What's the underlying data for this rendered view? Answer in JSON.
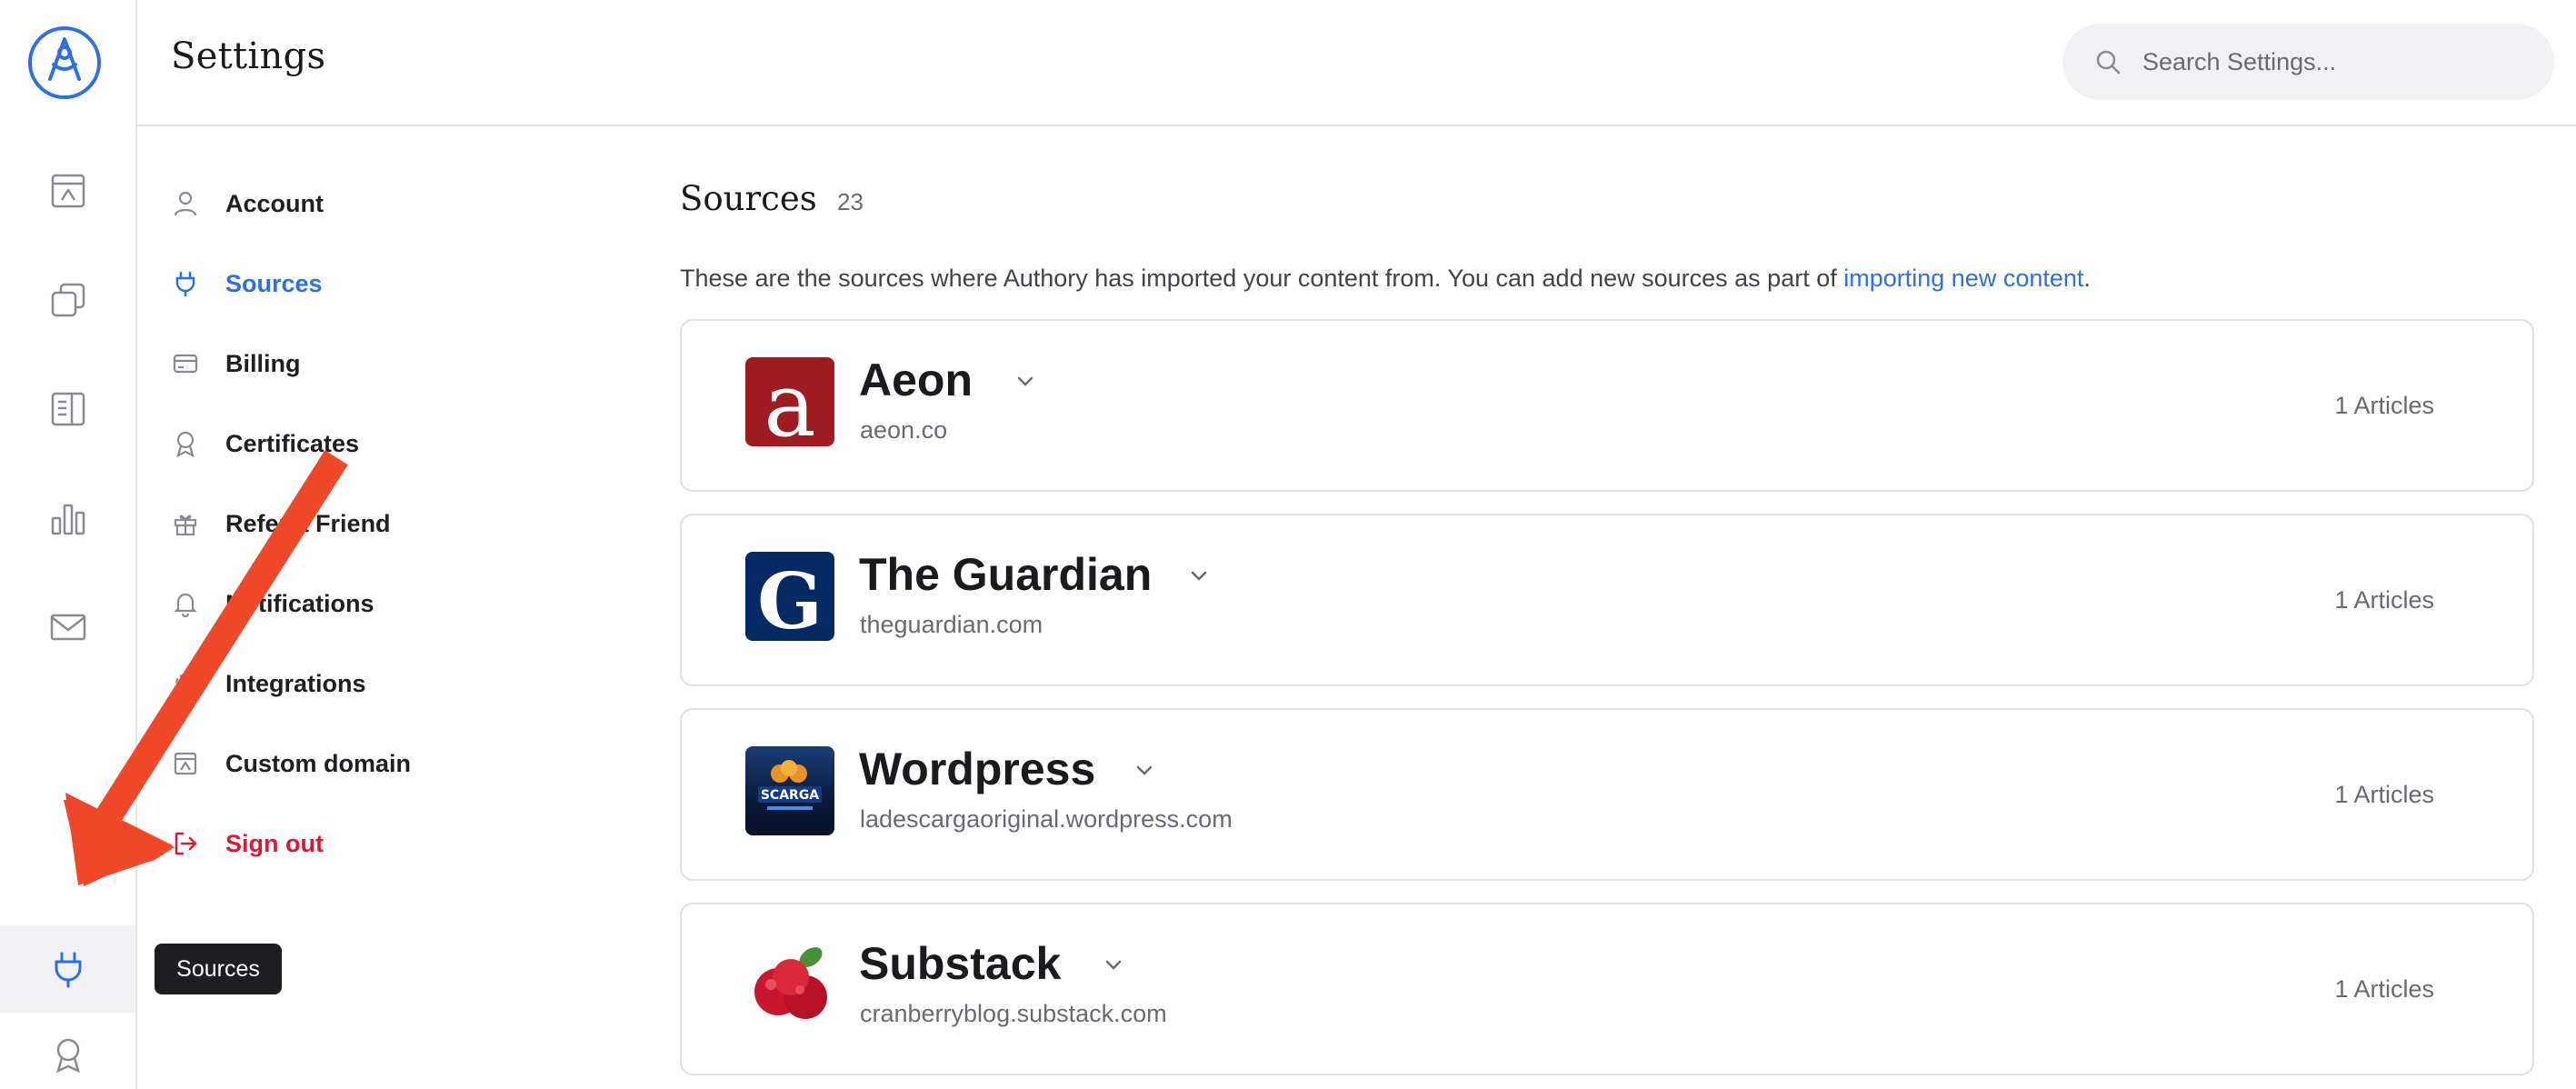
{
  "header": {
    "title": "Settings",
    "search_placeholder": "Search Settings..."
  },
  "rail": {
    "items": [
      {
        "icon": "portfolio-icon",
        "active": false
      },
      {
        "icon": "collections-icon",
        "active": false
      },
      {
        "icon": "articles-icon",
        "active": false
      },
      {
        "icon": "analytics-icon",
        "active": false
      },
      {
        "icon": "mail-icon",
        "active": false
      },
      {
        "icon": "plug-icon",
        "active": true
      },
      {
        "icon": "award-icon",
        "active": false
      }
    ],
    "tooltip": "Sources"
  },
  "nav": {
    "items": [
      {
        "label": "Account",
        "icon": "user-icon"
      },
      {
        "label": "Sources",
        "icon": "plug-icon"
      },
      {
        "label": "Billing",
        "icon": "credit-card-icon"
      },
      {
        "label": "Certificates",
        "icon": "award-icon"
      },
      {
        "label": "Refer a Friend",
        "icon": "gift-icon"
      },
      {
        "label": "Notifications",
        "icon": "bell-icon"
      },
      {
        "label": "Integrations",
        "icon": "gear-icon"
      },
      {
        "label": "Custom domain",
        "icon": "portfolio-icon"
      },
      {
        "label": "Sign out",
        "icon": "sign-out-icon"
      }
    ],
    "active": "Sources"
  },
  "main": {
    "title": "Sources",
    "count": "23",
    "description_prefix": "These are the sources where Authory has imported your content from. You can add new sources as part of ",
    "description_link": "importing new content",
    "description_suffix": "."
  },
  "sources": [
    {
      "name": "Aeon",
      "url": "aeon.co",
      "articles": "1 Articles",
      "logo_letter": "a",
      "logo_color": "#9e1b1f"
    },
    {
      "name": "The Guardian",
      "url": "theguardian.com",
      "articles": "1 Articles",
      "logo_letter": "G",
      "logo_color": "#052962"
    },
    {
      "name": "Wordpress",
      "url": "ladescargaoriginal.wordpress.com",
      "articles": "1 Articles",
      "logo_letter": "SCARGA",
      "logo_color": "#0d2a55"
    },
    {
      "name": "Substack",
      "url": "cranberryblog.substack.com",
      "articles": "1 Articles",
      "logo_letter": "",
      "logo_color": "#c8102e"
    }
  ],
  "colors": {
    "accent": "#2f6fe0",
    "danger": "#d81c36",
    "annotation_arrow": "#f0482a"
  }
}
